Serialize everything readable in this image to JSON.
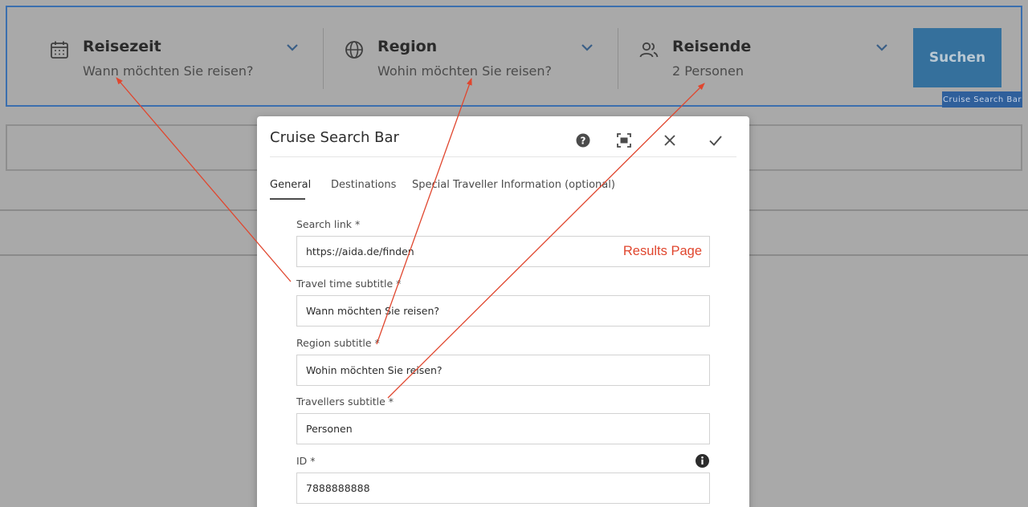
{
  "search_bar": {
    "segments": [
      {
        "title": "Reisezeit",
        "subtitle": "Wann möchten Sie reisen?",
        "icon": "calendar-icon"
      },
      {
        "title": "Region",
        "subtitle": "Wohin möchten Sie reisen?",
        "icon": "globe-icon"
      },
      {
        "title": "Reisende",
        "subtitle": "2 Personen",
        "icon": "users-icon"
      }
    ],
    "search_button": "Suchen",
    "component_label": "Cruise Search Bar"
  },
  "dialog": {
    "title": "Cruise Search Bar",
    "actions": [
      "help-icon",
      "fullscreen-icon",
      "close-icon",
      "confirm-icon"
    ],
    "tabs": [
      "General",
      "Destinations",
      "Special Traveller Information (optional)"
    ],
    "active_tab": "General",
    "fields": [
      {
        "label": "Search link *",
        "value": "https://aida.de/finden",
        "annotation": "Results Page"
      },
      {
        "label": "Travel time subtitle *",
        "value": "Wann möchten Sie reisen?"
      },
      {
        "label": "Region subtitle *",
        "value": "Wohin möchten Sie reisen?"
      },
      {
        "label": "Travellers subtitle *",
        "value": "Personen"
      },
      {
        "label": "ID *",
        "value": "7888888888"
      }
    ]
  },
  "colors": {
    "overlay_gray": "#a9a9a9",
    "accent_blue": "#35709c",
    "annotation_red": "#e0462e",
    "frame_blue": "#3b6fae"
  }
}
